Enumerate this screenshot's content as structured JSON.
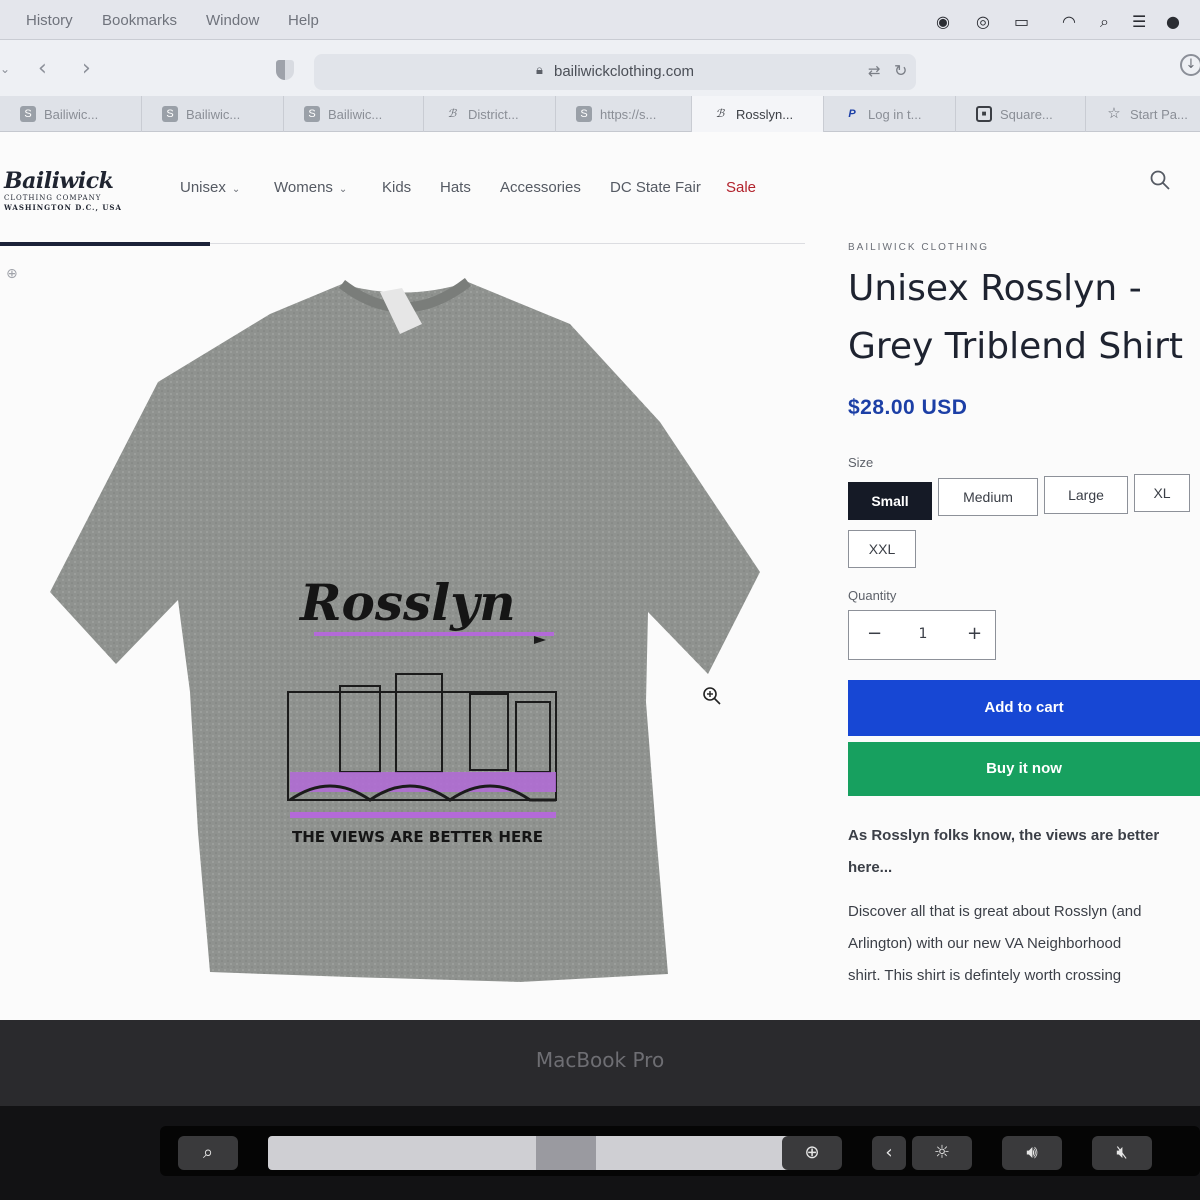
{
  "menubar": {
    "items": [
      "History",
      "Bookmarks",
      "Window",
      "Help"
    ]
  },
  "toolbar": {
    "url": "bailiwickclothing.com"
  },
  "tabs": [
    {
      "label": "Bailiwic...",
      "icon": "shop-icon"
    },
    {
      "label": "Bailiwic...",
      "icon": "shop-icon"
    },
    {
      "label": "Bailiwic...",
      "icon": "shop-icon"
    },
    {
      "label": "District...",
      "icon": "b-logo-icon"
    },
    {
      "label": "https://s...",
      "icon": "s-icon"
    },
    {
      "label": "Rosslyn...",
      "icon": "b-logo-icon",
      "active": true
    },
    {
      "label": "Log in t...",
      "icon": "paypal-icon"
    },
    {
      "label": "Square...",
      "icon": "square-icon"
    },
    {
      "label": "Start Pa...",
      "icon": "star-icon"
    }
  ],
  "site": {
    "logo": {
      "name": "Bailiwick",
      "line1": "CLOTHING COMPANY",
      "line2": "WASHINGTON D.C., USA"
    },
    "nav": [
      {
        "label": "Unisex",
        "has_dropdown": true
      },
      {
        "label": "Womens",
        "has_dropdown": true
      },
      {
        "label": "Kids"
      },
      {
        "label": "Hats"
      },
      {
        "label": "Accessories"
      },
      {
        "label": "DC State Fair"
      },
      {
        "label": "Sale"
      }
    ]
  },
  "product": {
    "vendor": "BAILIWICK CLOTHING",
    "title_line1": "Unisex Rosslyn -",
    "title_line2": "Grey Triblend Shirt",
    "price": "$28.00 USD",
    "size_label": "Size",
    "sizes": [
      "Small",
      "Medium",
      "Large",
      "XL",
      "XXL"
    ],
    "selected_size": "Small",
    "quantity_label": "Quantity",
    "quantity": "1",
    "add_to_cart": "Add to cart",
    "buy_now": "Buy it now",
    "description_lead_1": "As Rosslyn folks know, the views are better",
    "description_lead_2": "here...",
    "description_1": "Discover all that is great about Rosslyn (and",
    "description_2": "Arlington) with our new VA Neighborhood",
    "description_3": "shirt. This shirt is defintely worth crossing"
  },
  "shirt_print": {
    "script": "Rosslyn",
    "tagline": "THE VIEWS ARE BETTER HERE"
  },
  "device": {
    "label": "MacBook Pro"
  },
  "colors": {
    "price": "#1c3fa6",
    "add_to_cart": "#1747d4",
    "buy_now": "#17a05f",
    "sale": "#b2222c",
    "selected_size": "#151a26",
    "print_accent": "#b36ad8"
  }
}
